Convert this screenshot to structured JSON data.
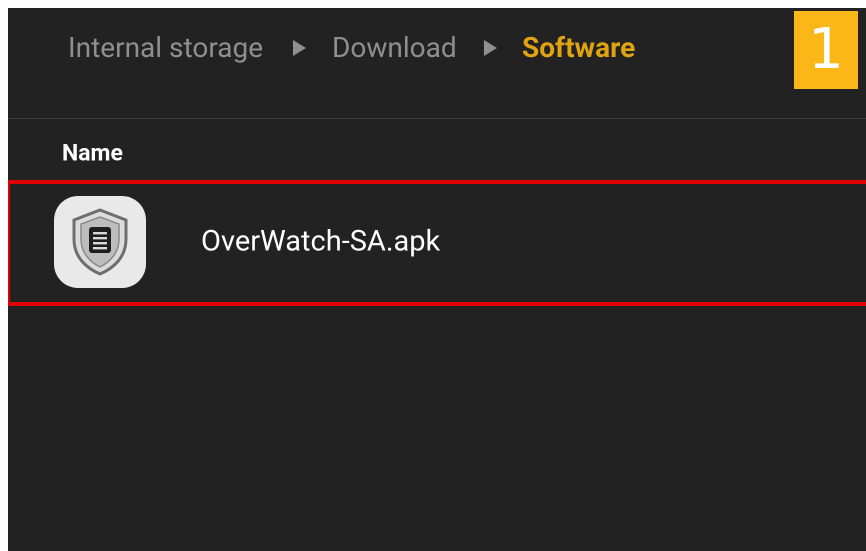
{
  "breadcrumb": {
    "items": [
      {
        "label": "Internal storage"
      },
      {
        "label": "Download"
      },
      {
        "label": "Software"
      }
    ]
  },
  "step_badge": {
    "label": "1"
  },
  "list": {
    "column_header": "Name",
    "files": [
      {
        "name": "OverWatch-SA.apk",
        "icon": "overwatch-shield-icon"
      }
    ]
  },
  "colors": {
    "background": "#222222",
    "breadcrumb_inactive": "#8f8f8f",
    "breadcrumb_active": "#e0a312",
    "badge": "#fbb717",
    "highlight": "#e00000"
  }
}
